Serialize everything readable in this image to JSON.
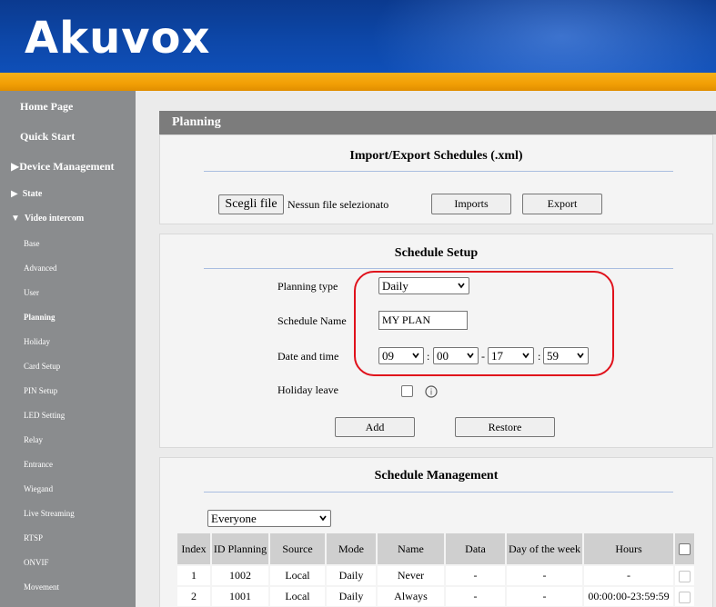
{
  "header": {
    "logo": "Akuvox"
  },
  "sidebar": {
    "home": "Home Page",
    "quick_start": "Quick Start",
    "device_management": "Device Management",
    "state": "State",
    "video_intercom": "Video intercom",
    "items": [
      "Base",
      "Advanced",
      "User",
      "Planning",
      "Holiday",
      "Card Setup",
      "PIN Setup",
      "LED Setting",
      "Relay",
      "Entrance",
      "Wiegand",
      "Live Streaming",
      "RTSP",
      "ONVIF",
      "Movement"
    ],
    "active": "Planning"
  },
  "page": {
    "title": "Planning"
  },
  "import_export": {
    "heading": "Import/Export Schedules (.xml)",
    "choose_file": "Scegli file",
    "no_file": "Nessun file selezionato",
    "imports": "Imports",
    "export": "Export"
  },
  "schedule_setup": {
    "heading": "Schedule Setup",
    "planning_type_label": "Planning type",
    "planning_type_value": "Daily",
    "schedule_name_label": "Schedule Name",
    "schedule_name_value": "MY PLAN",
    "date_time_label": "Date and time",
    "time": {
      "start_hour": "09",
      "start_min": "00",
      "end_hour": "17",
      "end_min": "59"
    },
    "holiday_leave_label": "Holiday leave",
    "info_icon": "i",
    "add": "Add",
    "restore": "Restore"
  },
  "schedule_management": {
    "heading": "Schedule Management",
    "filter": "Everyone",
    "columns": [
      "Index",
      "ID Planning",
      "Source",
      "Mode",
      "Name",
      "Data",
      "Day of the week",
      "Hours"
    ],
    "rows": [
      [
        "1",
        "1002",
        "Local",
        "Daily",
        "Never",
        "-",
        "-",
        "-"
      ],
      [
        "2",
        "1001",
        "Local",
        "Daily",
        "Always",
        "-",
        "-",
        "00:00:00-23:59:59"
      ]
    ]
  }
}
